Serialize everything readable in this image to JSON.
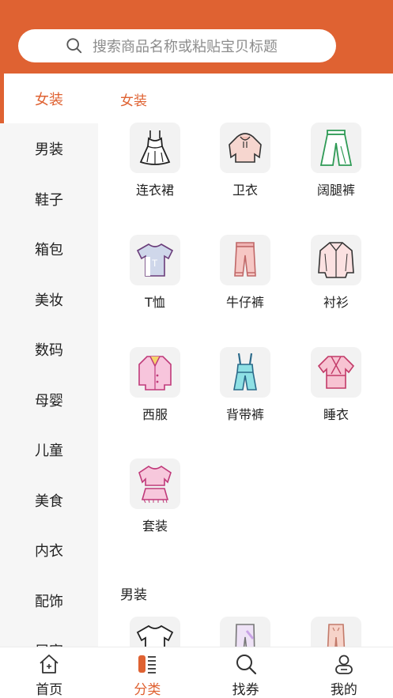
{
  "search": {
    "placeholder": "搜索商品名称或粘贴宝贝标题"
  },
  "sidebar": {
    "items": [
      {
        "label": "女装",
        "active": true
      },
      {
        "label": "男装"
      },
      {
        "label": "鞋子"
      },
      {
        "label": "箱包"
      },
      {
        "label": "美妆"
      },
      {
        "label": "数码"
      },
      {
        "label": "母婴"
      },
      {
        "label": "儿童"
      },
      {
        "label": "美食"
      },
      {
        "label": "内衣"
      },
      {
        "label": "配饰"
      },
      {
        "label": "居家"
      }
    ]
  },
  "sections": [
    {
      "title": "女装",
      "items": [
        {
          "label": "连衣裙",
          "icon": "dress-icon"
        },
        {
          "label": "卫衣",
          "icon": "hoodie-icon"
        },
        {
          "label": "阔腿裤",
          "icon": "wide-leg-pants-icon"
        },
        {
          "label": "T恤",
          "icon": "tshirt-icon"
        },
        {
          "label": "牛仔裤",
          "icon": "jeans-icon"
        },
        {
          "label": "衬衫",
          "icon": "shirt-icon"
        },
        {
          "label": "西服",
          "icon": "suit-icon"
        },
        {
          "label": "背带裤",
          "icon": "overalls-icon"
        },
        {
          "label": "睡衣",
          "icon": "pajamas-icon"
        },
        {
          "label": "套装",
          "icon": "outfit-set-icon"
        }
      ]
    },
    {
      "title": "男装",
      "items": [
        {
          "label": "",
          "icon": "tshirt-icon"
        },
        {
          "label": "",
          "icon": "sweatpants-icon"
        },
        {
          "label": "",
          "icon": "pants-icon"
        }
      ]
    }
  ],
  "tabbar": {
    "items": [
      {
        "label": "首页",
        "icon": "home-icon"
      },
      {
        "label": "分类",
        "icon": "category-icon",
        "active": true
      },
      {
        "label": "找券",
        "icon": "search-icon"
      },
      {
        "label": "我的",
        "icon": "profile-icon"
      }
    ]
  },
  "colors": {
    "accent": "#df6232",
    "sidebar_bg": "#f6f6f6",
    "tile_bg": "#f2f2f2"
  }
}
